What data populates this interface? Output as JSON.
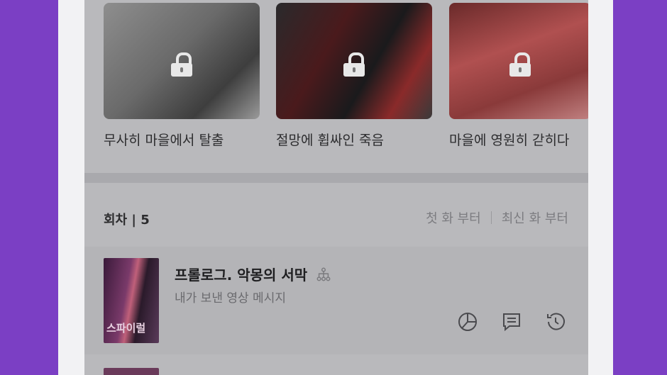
{
  "endings": [
    {
      "title": "무사히 마을에서 탈출",
      "locked": true
    },
    {
      "title": "절망에 휩싸인 죽음",
      "locked": true
    },
    {
      "title": "마을에 영원히 갇히다",
      "locked": true
    }
  ],
  "episodes_header": {
    "label": "회차 | 5"
  },
  "sort": {
    "first": "첫 화 부터",
    "latest": "최신 화 부터"
  },
  "episode": {
    "title": "프롤로그. 악몽의 서막",
    "subtitle": "내가 보낸 영상 메시지",
    "thumb_text": "스파이럴"
  },
  "icons": [
    "lock-icon",
    "branch-icon",
    "pie-chart-icon",
    "comment-icon",
    "history-icon"
  ]
}
